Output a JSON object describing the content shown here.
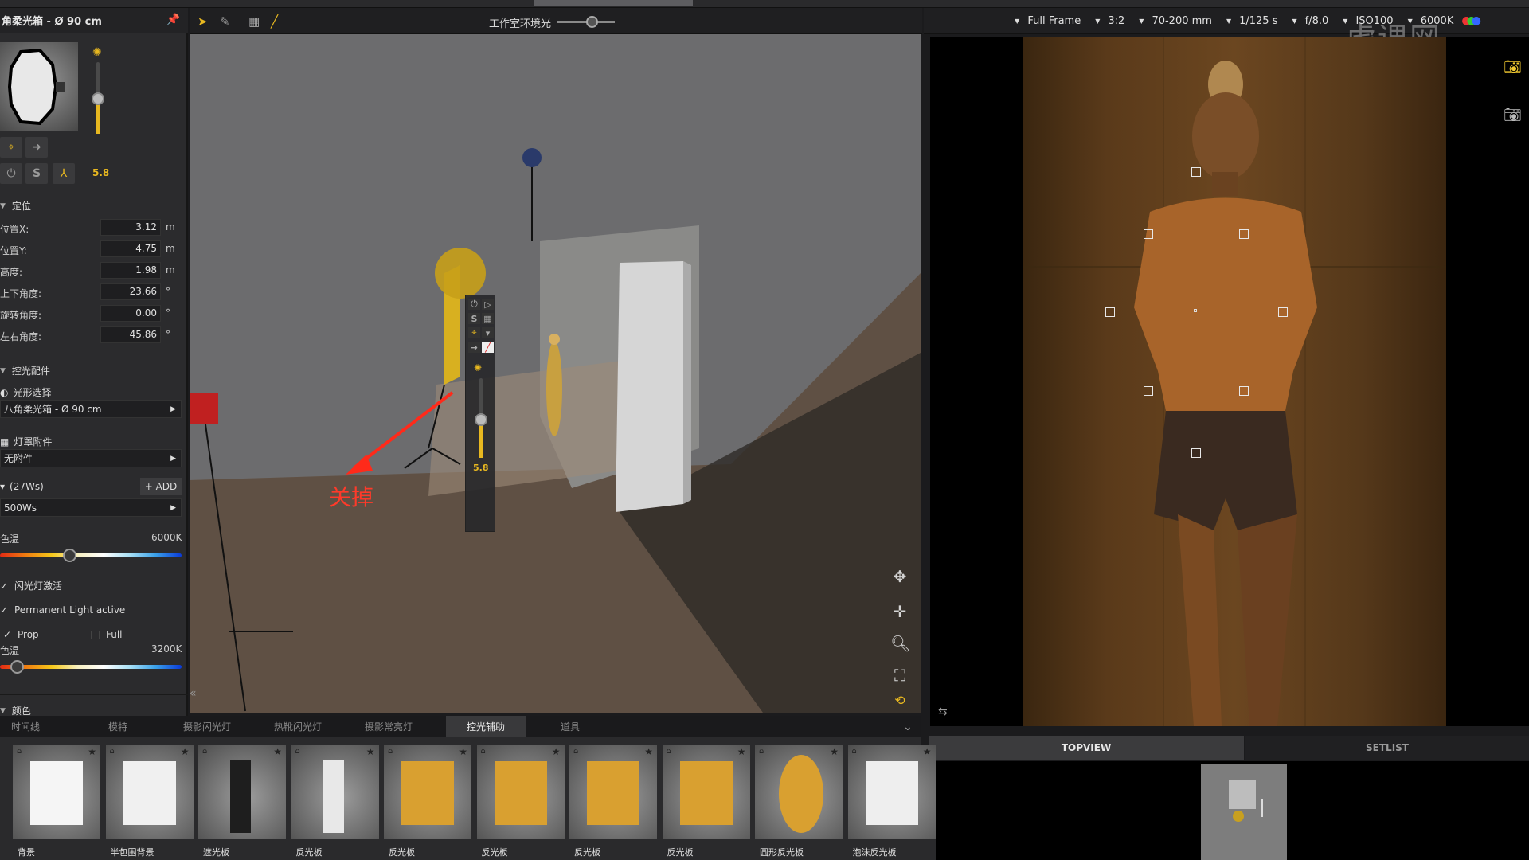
{
  "left_panel": {
    "title": "角柔光箱 - Ø 90 cm",
    "power_value": "5.8",
    "section_positioning": "定位",
    "properties": [
      {
        "label": "位置X:",
        "value": "3.12",
        "unit": "m"
      },
      {
        "label": "位置Y:",
        "value": "4.75",
        "unit": "m"
      },
      {
        "label": "高度:",
        "value": "1.98",
        "unit": "m"
      },
      {
        "label": "上下角度:",
        "value": "23.66",
        "unit": "°"
      },
      {
        "label": "旋转角度:",
        "value": "0.00",
        "unit": "°"
      },
      {
        "label": "左右角度:",
        "value": "45.86",
        "unit": "°"
      }
    ],
    "section_modifiers": "控光配件",
    "shape_select_label": "光形选择",
    "shape_select_value": "八角柔光箱 - Ø 90 cm",
    "attachment_label": "灯罩附件",
    "attachment_value": "无附件",
    "flash_label": "(27Ws)",
    "add_label": "+ ADD",
    "flash_value": "500Ws",
    "color_temp_label": "色温",
    "color_temp_value": "6000K",
    "color_temp_fraction": 0.38,
    "flash_active_label": "闪光灯激活",
    "permanent_label": "Permanent Light active",
    "prop_label": "Prop",
    "full_label": "Full",
    "prop_checked": true,
    "full_checked": false,
    "color_temp2_label": "色温",
    "color_temp2_value": "3200K",
    "color_temp2_fraction": 0.09,
    "section_color": "颜色"
  },
  "viewport": {
    "ambient_label": "工作室环境光",
    "ambient_fraction": 0.6,
    "annotation": "关掉",
    "light_toolbar_value": "5.8"
  },
  "camera_bar": {
    "options": [
      "Full Frame",
      "3:2",
      "70-200 mm",
      "1/125 s",
      "f/8.0",
      "ISO100",
      "6000K"
    ]
  },
  "right_tabs": {
    "topview": "TOPVIEW",
    "setlist": "SETLIST"
  },
  "library": {
    "tabs": [
      "时间线",
      "模特",
      "摄影闪光灯",
      "热靴闪光灯",
      "摄影常亮灯",
      "控光辅助",
      "道具"
    ],
    "active_tab": "控光辅助",
    "items": [
      "背景",
      "半包围背景",
      "遮光板",
      "反光板",
      "反光板",
      "反光板",
      "反光板",
      "反光板",
      "圆形反光板",
      "泡沫反光板"
    ]
  },
  "watermark": "虎课网"
}
